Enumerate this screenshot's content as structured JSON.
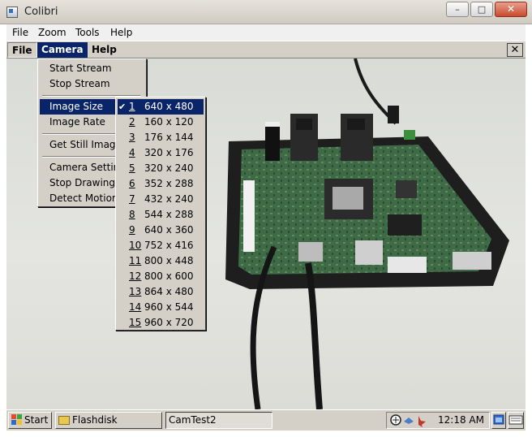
{
  "window": {
    "title": "Colibri",
    "controls": {
      "minimize": "–",
      "maximize": "□",
      "close": "✕"
    }
  },
  "outer_menu": [
    "File",
    "Zoom",
    "Tools",
    "Help"
  ],
  "inner_menu": {
    "file": "File",
    "camera": "Camera",
    "help": "Help",
    "close": "✕"
  },
  "camera_menu": {
    "items": [
      "Start Stream",
      "Stop Stream",
      "Image Size",
      "Image Rate",
      "Get Still Image",
      "Camera Settings",
      "Stop Drawing",
      "Detect Motion"
    ],
    "selected": "Image Size"
  },
  "image_size_menu": {
    "checked": "1",
    "options": [
      {
        "num": "1",
        "size": "640 x 480"
      },
      {
        "num": "2",
        "size": "160 x 120"
      },
      {
        "num": "3",
        "size": "176 x 144"
      },
      {
        "num": "4",
        "size": "320 x 176"
      },
      {
        "num": "5",
        "size": "320 x 240"
      },
      {
        "num": "6",
        "size": "352 x 288"
      },
      {
        "num": "7",
        "size": "432 x 240"
      },
      {
        "num": "8",
        "size": "544 x 288"
      },
      {
        "num": "9",
        "size": "640 x 360"
      },
      {
        "num": "10",
        "size": "752 x 416"
      },
      {
        "num": "11",
        "size": "800 x 448"
      },
      {
        "num": "12",
        "size": "800 x 600"
      },
      {
        "num": "13",
        "size": "864 x 480"
      },
      {
        "num": "14",
        "size": "960 x 544"
      },
      {
        "num": "15",
        "size": "960 x 720"
      }
    ]
  },
  "taskbar": {
    "start": "Start",
    "windows": [
      "Flashdisk",
      "CamTest2"
    ],
    "clock": "12:18 AM"
  },
  "colors": {
    "menu_highlight": "#0a246a",
    "menu_bg": "#d4d0c8",
    "board_green": "#3e6b45"
  }
}
